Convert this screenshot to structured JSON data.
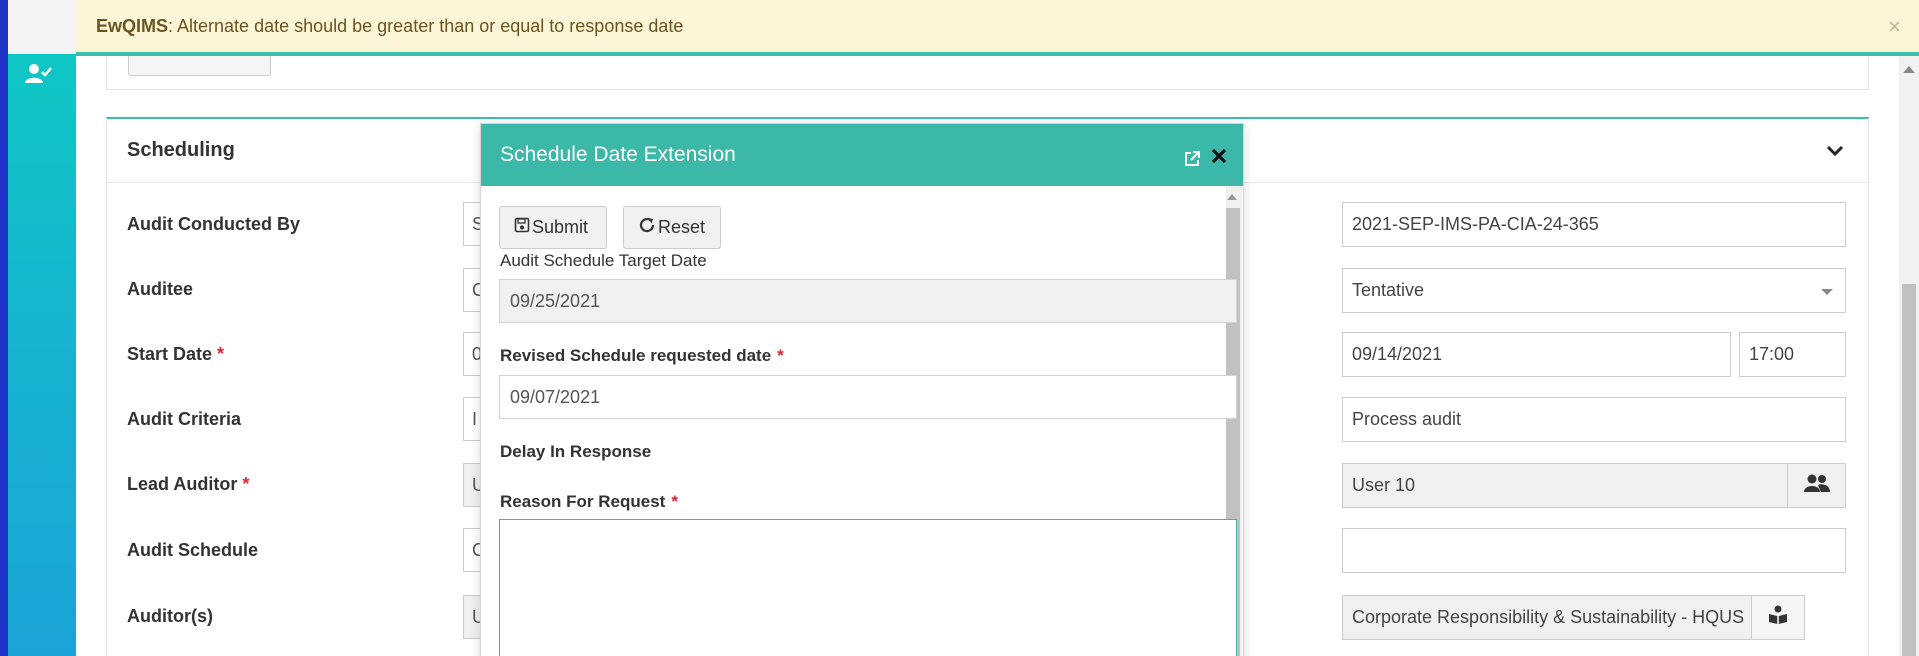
{
  "notification": {
    "app": "EwQIMS",
    "message": " : Alternate date should be greater than or equal to response date",
    "close": "×"
  },
  "scheduling": {
    "title": "Scheduling",
    "labels": {
      "audit_conducted_by": "Audit Conducted By",
      "auditee": "Auditee",
      "start_date": "Start Date",
      "audit_criteria": "Audit Criteria",
      "lead_auditor": "Lead Auditor",
      "audit_schedule": "Audit Schedule",
      "auditors": "Auditor(s)",
      "required": "*"
    },
    "left_fields": {
      "audit_conducted_by": "S",
      "auditee": "C",
      "start_date": "0",
      "audit_criteria": "I",
      "lead_auditor": "U",
      "audit_schedule": "C",
      "auditors": "U"
    },
    "right_fields": {
      "reference_no": "2021-SEP-IMS-PA-CIA-24-365",
      "status": "Tentative",
      "end_date": "09/14/2021",
      "end_time": "17:00",
      "audit_type": "Process audit",
      "user": "User 10",
      "blank": "",
      "organization": "Corporate Responsibility & Sustainability - HQUS"
    }
  },
  "modal": {
    "title": "Schedule Date Extension",
    "submit_label": "Submit",
    "reset_label": "Reset",
    "target_date_label": "Audit Schedule Target Date",
    "target_date_value": "09/25/2021",
    "revised_label": "Revised Schedule requested date",
    "revised_value": "09/07/2021",
    "delay_label": "Delay In Response",
    "reason_label": "Reason For Request",
    "required": "*"
  }
}
